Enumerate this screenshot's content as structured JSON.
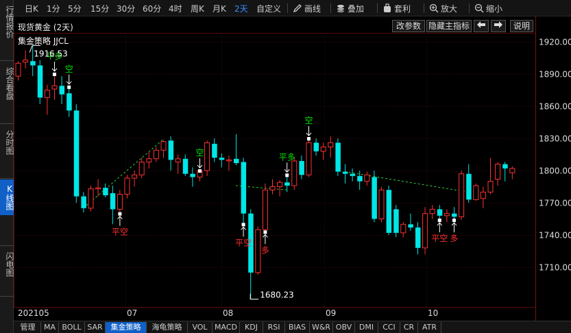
{
  "sidebar": {
    "tabs": [
      {
        "label": "行情报价",
        "active": false
      },
      {
        "label": "综合看盘",
        "active": false
      },
      {
        "label": "分时图",
        "active": false
      },
      {
        "label": "K线图",
        "active": true
      },
      {
        "label": "闪电图",
        "active": false
      }
    ]
  },
  "toolbar": {
    "timeframes": [
      {
        "label": "日K",
        "active": false
      },
      {
        "label": "1分",
        "active": false
      },
      {
        "label": "5分",
        "active": false
      },
      {
        "label": "15分",
        "active": false
      },
      {
        "label": "30分",
        "active": false
      },
      {
        "label": "60分",
        "active": false
      },
      {
        "label": "4时",
        "active": false
      },
      {
        "label": "周K",
        "active": false
      },
      {
        "label": "月K",
        "active": false
      },
      {
        "label": "2天",
        "active": true
      },
      {
        "label": "自定义",
        "active": false
      }
    ],
    "tools": {
      "draw": "画线",
      "overlay": "叠加",
      "rights": "套利",
      "zoom_in": "放大",
      "zoom_out": "缩小"
    }
  },
  "header": {
    "title": "现货黄金 (2天)",
    "change_params": "改参数",
    "hide_indicator": "隐藏主指标",
    "explain": "说明"
  },
  "strategy_label": "集金策略 JJCL",
  "bottom_tabs": [
    {
      "label": "管理",
      "active": false
    },
    {
      "label": "MA",
      "active": false
    },
    {
      "label": "BOLL",
      "active": false
    },
    {
      "label": "SAR",
      "active": false
    },
    {
      "label": "集金策略",
      "active": true
    },
    {
      "label": "海龟策略",
      "active": false
    },
    {
      "label": "VOL",
      "active": false
    },
    {
      "label": "MACD",
      "active": false
    },
    {
      "label": "KDJ",
      "active": false
    },
    {
      "label": "RSI",
      "active": false
    },
    {
      "label": "BIAS",
      "active": false
    },
    {
      "label": "W&R",
      "active": false
    },
    {
      "label": "OBV",
      "active": false
    },
    {
      "label": "DMI",
      "active": false
    },
    {
      "label": "CCI",
      "active": false
    },
    {
      "label": "CR",
      "active": false
    },
    {
      "label": "ATR",
      "active": false
    }
  ],
  "colors": {
    "up": "#ff3232",
    "down": "#00e5e5",
    "signal_buy": "#ff3030",
    "signal_sell": "#00e000",
    "grid": "#3a0a0a",
    "accent": "#1060c8"
  },
  "chart_data": {
    "type": "candlestick",
    "instrument": "现货黄金",
    "period": "2天",
    "ylim": [
      1680,
      1930
    ],
    "y_ticks": [
      1710.0,
      1740.0,
      1770.0,
      1800.0,
      1830.0,
      1860.0,
      1890.0,
      1920.0
    ],
    "x_labels": [
      "202105",
      "07",
      "08",
      "09",
      "10"
    ],
    "annotations": {
      "high": {
        "label": "1916.53",
        "value": 1916.53
      },
      "low": {
        "label": "1680.23",
        "value": 1680.23
      }
    },
    "candles": [
      {
        "o": 1888,
        "h": 1902,
        "l": 1884,
        "c": 1900
      },
      {
        "o": 1901,
        "h": 1912,
        "l": 1895,
        "c": 1903
      },
      {
        "o": 1902,
        "h": 1916.5,
        "l": 1888,
        "c": 1898
      },
      {
        "o": 1898,
        "h": 1903,
        "l": 1862,
        "c": 1868
      },
      {
        "o": 1868,
        "h": 1880,
        "l": 1852,
        "c": 1875
      },
      {
        "o": 1876,
        "h": 1890,
        "l": 1866,
        "c": 1879
      },
      {
        "o": 1879,
        "h": 1888,
        "l": 1862,
        "c": 1871
      },
      {
        "o": 1872,
        "h": 1878,
        "l": 1850,
        "c": 1856
      },
      {
        "o": 1856,
        "h": 1862,
        "l": 1770,
        "c": 1776
      },
      {
        "o": 1776,
        "h": 1780,
        "l": 1761,
        "c": 1765
      },
      {
        "o": 1765,
        "h": 1786,
        "l": 1762,
        "c": 1783
      },
      {
        "o": 1783,
        "h": 1792,
        "l": 1776,
        "c": 1784
      },
      {
        "o": 1784,
        "h": 1788,
        "l": 1775,
        "c": 1777
      },
      {
        "o": 1779,
        "h": 1786,
        "l": 1750,
        "c": 1764
      },
      {
        "o": 1764,
        "h": 1782,
        "l": 1760,
        "c": 1778
      },
      {
        "o": 1778,
        "h": 1796,
        "l": 1774,
        "c": 1793
      },
      {
        "o": 1793,
        "h": 1800,
        "l": 1785,
        "c": 1796
      },
      {
        "o": 1796,
        "h": 1812,
        "l": 1793,
        "c": 1808
      },
      {
        "o": 1808,
        "h": 1818,
        "l": 1802,
        "c": 1811
      },
      {
        "o": 1811,
        "h": 1822,
        "l": 1808,
        "c": 1819
      },
      {
        "o": 1819,
        "h": 1828,
        "l": 1812,
        "c": 1827
      },
      {
        "o": 1828,
        "h": 1832,
        "l": 1800,
        "c": 1810
      },
      {
        "o": 1808,
        "h": 1815,
        "l": 1797,
        "c": 1811
      },
      {
        "o": 1811,
        "h": 1815,
        "l": 1795,
        "c": 1797
      },
      {
        "o": 1797,
        "h": 1803,
        "l": 1785,
        "c": 1794
      },
      {
        "o": 1794,
        "h": 1800,
        "l": 1790,
        "c": 1800
      },
      {
        "o": 1800,
        "h": 1828,
        "l": 1795,
        "c": 1826
      },
      {
        "o": 1825,
        "h": 1830,
        "l": 1808,
        "c": 1812
      },
      {
        "o": 1812,
        "h": 1816,
        "l": 1803,
        "c": 1810
      },
      {
        "o": 1810,
        "h": 1814,
        "l": 1800,
        "c": 1810
      },
      {
        "o": 1811,
        "h": 1834,
        "l": 1805,
        "c": 1807
      },
      {
        "o": 1808,
        "h": 1812,
        "l": 1750,
        "c": 1760
      },
      {
        "o": 1760,
        "h": 1764,
        "l": 1680.23,
        "c": 1705
      },
      {
        "o": 1705,
        "h": 1748,
        "l": 1703,
        "c": 1745
      },
      {
        "o": 1745,
        "h": 1788,
        "l": 1743,
        "c": 1782
      },
      {
        "o": 1782,
        "h": 1792,
        "l": 1778,
        "c": 1785
      },
      {
        "o": 1785,
        "h": 1791,
        "l": 1776,
        "c": 1789
      },
      {
        "o": 1789,
        "h": 1796,
        "l": 1780,
        "c": 1786
      },
      {
        "o": 1786,
        "h": 1812,
        "l": 1782,
        "c": 1809
      },
      {
        "o": 1809,
        "h": 1814,
        "l": 1792,
        "c": 1796
      },
      {
        "o": 1796,
        "h": 1830,
        "l": 1794,
        "c": 1826
      },
      {
        "o": 1826,
        "h": 1830,
        "l": 1814,
        "c": 1818
      },
      {
        "o": 1818,
        "h": 1826,
        "l": 1810,
        "c": 1822
      },
      {
        "o": 1822,
        "h": 1832,
        "l": 1812,
        "c": 1826
      },
      {
        "o": 1826,
        "h": 1830,
        "l": 1795,
        "c": 1799
      },
      {
        "o": 1799,
        "h": 1806,
        "l": 1788,
        "c": 1797
      },
      {
        "o": 1797,
        "h": 1802,
        "l": 1790,
        "c": 1795
      },
      {
        "o": 1795,
        "h": 1800,
        "l": 1782,
        "c": 1790
      },
      {
        "o": 1790,
        "h": 1799,
        "l": 1786,
        "c": 1796
      },
      {
        "o": 1794,
        "h": 1800,
        "l": 1752,
        "c": 1755
      },
      {
        "o": 1755,
        "h": 1785,
        "l": 1752,
        "c": 1782
      },
      {
        "o": 1782,
        "h": 1786,
        "l": 1740,
        "c": 1742
      },
      {
        "o": 1764,
        "h": 1768,
        "l": 1738,
        "c": 1742
      },
      {
        "o": 1742,
        "h": 1752,
        "l": 1738,
        "c": 1750
      },
      {
        "o": 1750,
        "h": 1760,
        "l": 1744,
        "c": 1747
      },
      {
        "o": 1747,
        "h": 1752,
        "l": 1722,
        "c": 1728
      },
      {
        "o": 1728,
        "h": 1766,
        "l": 1722,
        "c": 1760
      },
      {
        "o": 1760,
        "h": 1768,
        "l": 1755,
        "c": 1764
      },
      {
        "o": 1764,
        "h": 1768,
        "l": 1754,
        "c": 1758
      },
      {
        "o": 1758,
        "h": 1764,
        "l": 1752,
        "c": 1760
      },
      {
        "o": 1760,
        "h": 1766,
        "l": 1754,
        "c": 1757
      },
      {
        "o": 1757,
        "h": 1800,
        "l": 1754,
        "c": 1797
      },
      {
        "o": 1797,
        "h": 1806,
        "l": 1770,
        "c": 1773
      },
      {
        "o": 1773,
        "h": 1788,
        "l": 1772,
        "c": 1786
      },
      {
        "o": 1774,
        "h": 1785,
        "l": 1765,
        "c": 1780
      },
      {
        "o": 1780,
        "h": 1812,
        "l": 1778,
        "c": 1790
      },
      {
        "o": 1792,
        "h": 1808,
        "l": 1786,
        "c": 1806
      },
      {
        "o": 1806,
        "h": 1808,
        "l": 1790,
        "c": 1802
      },
      {
        "o": 1798,
        "h": 1804,
        "l": 1792,
        "c": 1802
      }
    ],
    "signals": [
      {
        "index": 5,
        "label": "平多",
        "kind": "sell"
      },
      {
        "index": 7,
        "label": "空",
        "kind": "sell"
      },
      {
        "index": 14,
        "label": "平空",
        "kind": "buy"
      },
      {
        "index": 25,
        "label": "空",
        "kind": "sell"
      },
      {
        "index": 31,
        "label": "平空",
        "kind": "buy"
      },
      {
        "index": 34,
        "label": "多",
        "kind": "buy"
      },
      {
        "index": 37,
        "label": "平多",
        "kind": "sell"
      },
      {
        "index": 40,
        "label": "空",
        "kind": "sell"
      },
      {
        "index": 58,
        "label": "平空",
        "kind": "buy"
      },
      {
        "index": 60,
        "label": "多",
        "kind": "buy"
      }
    ]
  }
}
